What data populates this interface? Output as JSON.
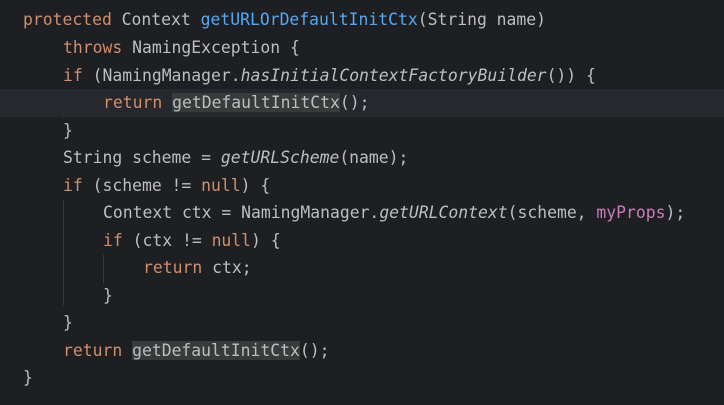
{
  "code": {
    "line1": {
      "kw": "protected",
      "type": " Context ",
      "method": "getURLOrDefaultInitCtx",
      "rest": "(String name)"
    },
    "line2": {
      "kw": "throws",
      "rest": " NamingException {"
    },
    "line3": {
      "kw": "if",
      "pre": " (NamingManager.",
      "call": "hasInitialContextFactoryBuilder",
      "rest": "()) {"
    },
    "line4": {
      "kw": "return",
      "call": "getDefaultInitCtx",
      "rest": "();"
    },
    "line5": {
      "text": "}"
    },
    "line6": {
      "pre": "String scheme = ",
      "call": "getURLScheme",
      "rest": "(name);"
    },
    "line7": {
      "kw": "if",
      "pre": " (scheme != ",
      "nullkw": "null",
      "rest": ") {"
    },
    "line8": {
      "pre": "Context ctx = NamingManager.",
      "call": "getURLContext",
      "mid": "(scheme, ",
      "field": "myProps",
      "rest": ");"
    },
    "line9": {
      "kw": "if",
      "pre": " (ctx != ",
      "nullkw": "null",
      "rest": ") {"
    },
    "line10": {
      "kw": "return",
      "rest": " ctx;"
    },
    "line11": {
      "text": "}"
    },
    "line12": {
      "text": "}"
    },
    "line13": {
      "kw": "return",
      "call": "getDefaultInitCtx",
      "rest": "();"
    },
    "line14": {
      "text": "}"
    }
  },
  "colors": {
    "background": "#1e1f22",
    "keyword": "#cf8e6d",
    "method": "#56a8f5",
    "field": "#c77dbb",
    "text": "#bcbec4"
  },
  "icons": [
    "intention-bulb-icon"
  ]
}
